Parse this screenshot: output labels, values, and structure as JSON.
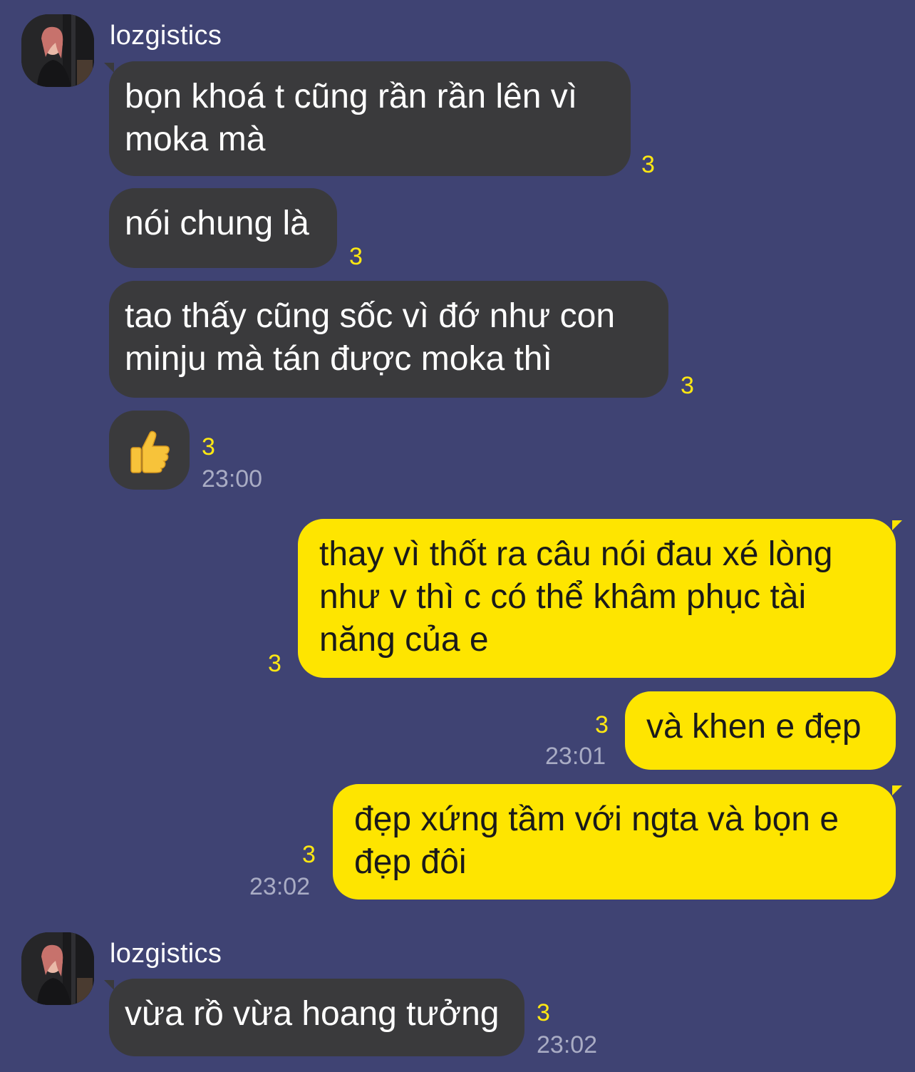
{
  "colors": {
    "background": "#3f4373",
    "incoming_bubble": "#3a3a3c",
    "outgoing_bubble": "#fee500",
    "unread_count": "#ffe812",
    "timestamp": "#a9acc4"
  },
  "messages": [
    {
      "id": 1,
      "direction": "in",
      "sender": "lozgistics",
      "text": "bọn khoá t cũng rần rần lên vì moka mà",
      "unread": "3",
      "time": ""
    },
    {
      "id": 2,
      "direction": "in",
      "text": "nói chung là",
      "unread": "3",
      "time": ""
    },
    {
      "id": 3,
      "direction": "in",
      "text": "tao thấy cũng sốc vì đớ như con minju mà tán được moka thì",
      "unread": "3",
      "time": ""
    },
    {
      "id": 4,
      "direction": "in",
      "emoji": "thumbs-up-icon",
      "unread": "3",
      "time": "23:00"
    },
    {
      "id": 5,
      "direction": "out",
      "text": "thay vì thốt ra câu nói đau xé lòng như v thì c có thể khâm phục tài năng của e",
      "unread": "3",
      "time": ""
    },
    {
      "id": 6,
      "direction": "out",
      "text": "và khen e đẹp",
      "unread": "3",
      "time": "23:01"
    },
    {
      "id": 7,
      "direction": "out",
      "text": "đẹp xứng tầm với ngta và bọn e đẹp đôi",
      "unread": "3",
      "time": "23:02"
    },
    {
      "id": 8,
      "direction": "in",
      "sender": "lozgistics",
      "text": "vừa rồ vừa hoang tưởng",
      "unread": "3",
      "time": "23:02"
    }
  ]
}
